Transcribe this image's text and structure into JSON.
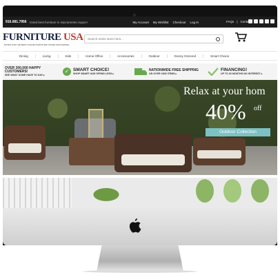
{
  "topbar": {
    "phone": "916.681.7956",
    "tagline": "Voted best furniture in Sacramento region!",
    "links": [
      "My Account",
      "My Wishlist",
      "Checkout",
      "Log In"
    ],
    "faq": "FAQs",
    "contact": "Contact"
  },
  "header": {
    "logo_main": "FURNITURE",
    "logo_accent": "USA",
    "logo_tagline": "RATED FOR THE BEST ONLINE FURNITURE STORE NATIONWIDE!",
    "search_placeholder": "Search entire store here..."
  },
  "nav": {
    "items": [
      "Dining",
      "Living",
      "Kids",
      "Home Office",
      "Accessories",
      "Outdoor",
      "Donny Osmond",
      "Smart Choice"
    ]
  },
  "promos": [
    {
      "title": "OVER 300,000 HAPPY CUSTOMERS!",
      "sub": "SEE WHAT SOME HAVE TO SAY ▸"
    },
    {
      "title": "SMART CHOICE!",
      "sub": "SHOP SMART AND SPEND LESS ▸"
    },
    {
      "title": "NATIONWIDE FREE SHIPPING",
      "sub": "ON OVER 1800 ITEMS ▸"
    },
    {
      "title": "FINANCING!",
      "sub": "UP TO 60 MONTHS NO INTEREST ▸"
    }
  ],
  "hero": {
    "headline": "Relax at your hom",
    "discount": "40%",
    "off": "off",
    "button": "Outdoor Collection"
  },
  "colors": {
    "accent_green": "#6aa84f",
    "logo_navy": "#15203f",
    "logo_red": "#c0392b",
    "button_teal": "#7ec1c4"
  }
}
